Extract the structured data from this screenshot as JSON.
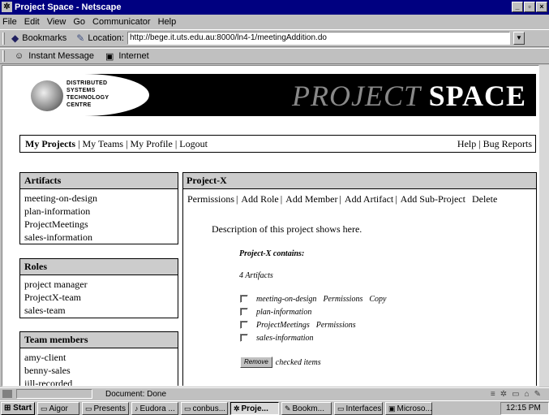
{
  "window": {
    "title": "Project Space - Netscape",
    "app_icon": "netscape-icon",
    "controls": [
      "_",
      "▫",
      "×"
    ]
  },
  "menu": [
    "File",
    "Edit",
    "View",
    "Go",
    "Communicator",
    "Help"
  ],
  "toolbar": {
    "bookmarks_label": "Bookmarks",
    "location_label": "Location:",
    "url": "http://bege.it.uts.edu.au:8000/ln4-1/meetingAddition.do"
  },
  "personal_bar": {
    "instant_message": "Instant Message",
    "internet": "Internet"
  },
  "banner": {
    "logo_lines": "DISTRIBUTED\nSYSTEMS\nTECHNOLOGY\nCENTRE",
    "title_part1": "PROJECT",
    "title_part2": "SPACE"
  },
  "nav": {
    "my_projects": "My Projects",
    "my_teams": "My Teams",
    "my_profile": "My Profile",
    "logout": "Logout",
    "help": "Help",
    "bug_reports": "Bug Reports",
    "sep": "|"
  },
  "artifacts_box": {
    "title": "Artifacts",
    "items": [
      "meeting-on-design",
      "plan-information",
      "ProjectMeetings",
      "sales-information"
    ]
  },
  "roles_box": {
    "title": "Roles",
    "items": [
      "project manager",
      "ProjectX-team",
      "sales-team"
    ]
  },
  "members_box": {
    "title": "Team members",
    "items": [
      "amy-client",
      "benny-sales",
      "jill-recorded"
    ]
  },
  "project": {
    "name": "Project-X",
    "actions": {
      "permissions": "Permissions",
      "add_role": "Add Role",
      "add_member": "Add Member",
      "add_artifact": "Add Artifact",
      "add_subproject": "Add Sub-Project",
      "delete": "Delete"
    },
    "description": "Description of this project shows here.",
    "contains_label": "Project-X contains:",
    "artifact_count": "4 Artifacts",
    "artifacts": [
      {
        "name": "meeting-on-design",
        "link1": "Permissions",
        "link2": "Copy"
      },
      {
        "name": "plan-information",
        "link1": "",
        "link2": ""
      },
      {
        "name": "ProjectMeetings",
        "link1": "Permissions",
        "link2": ""
      },
      {
        "name": "sales-information",
        "link1": "",
        "link2": ""
      }
    ],
    "remove_button": "Remove",
    "remove_suffix": "checked items"
  },
  "status": {
    "text": "Document: Done"
  },
  "taskbar": {
    "start": "Start",
    "tasks": [
      "Aigor",
      "Presents",
      "Eudora ...",
      "conbus...",
      "Proje...",
      "Bookm...",
      "Interfaces",
      "Microso..."
    ],
    "active_index": 4,
    "clock": "12:15 PM"
  }
}
